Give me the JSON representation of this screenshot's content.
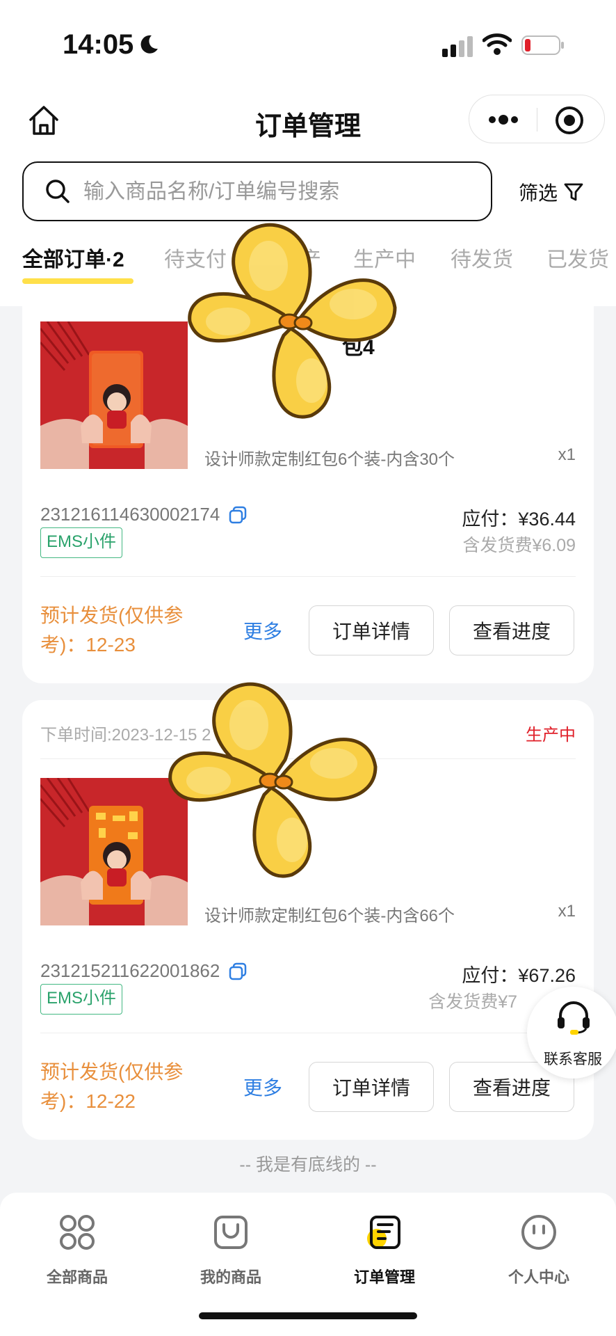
{
  "status_bar": {
    "time": "14:05"
  },
  "nav": {
    "title": "订单管理"
  },
  "search": {
    "placeholder": "输入商品名称/订单编号搜索",
    "filter_label": "筛选"
  },
  "tabs": [
    "全部订单·2",
    "待支付",
    "待生产",
    "生产中",
    "待发货",
    "已发货"
  ],
  "orders": [
    {
      "time_label": "",
      "status": "",
      "title_fragment": "包4",
      "spec": "设计师款定制红包6个装-内含30个",
      "qty": "x1",
      "order_no": "231216114630002174",
      "shipping": "EMS小件",
      "pay": "应付：¥36.44",
      "fee": "含发货费¥6.09",
      "estimate": "预计发货(仅供参考)：12-23",
      "more": "更多",
      "detail_btn": "订单详情",
      "progress_btn": "查看进度"
    },
    {
      "time_label": "下单时间:2023-12-15 2",
      "status": "生产中",
      "spec": "设计师款定制红包6个装-内含66个",
      "qty": "x1",
      "order_no": "231215211622001862",
      "shipping": "EMS小件",
      "pay": "应付：¥67.26",
      "fee": "含发货费¥7",
      "estimate": "预计发货(仅供参考)：12-22",
      "more": "更多",
      "detail_btn": "订单详情",
      "progress_btn": "查看进度"
    }
  ],
  "footer": "-- 我是有底线的 --",
  "service": {
    "label": "联系客服"
  },
  "tabbar": [
    {
      "label": "全部商品",
      "icon": "grid-icon"
    },
    {
      "label": "我的商品",
      "icon": "bag-icon"
    },
    {
      "label": "订单管理",
      "icon": "order-icon",
      "active": true
    },
    {
      "label": "个人中心",
      "icon": "smile-icon"
    }
  ],
  "colors": {
    "accent_yellow": "#ffe04a",
    "status_red": "#e0202a",
    "estimate_orange": "#e88f3c",
    "link_blue": "#2f7fe2",
    "badge_green": "#2aa26b"
  }
}
